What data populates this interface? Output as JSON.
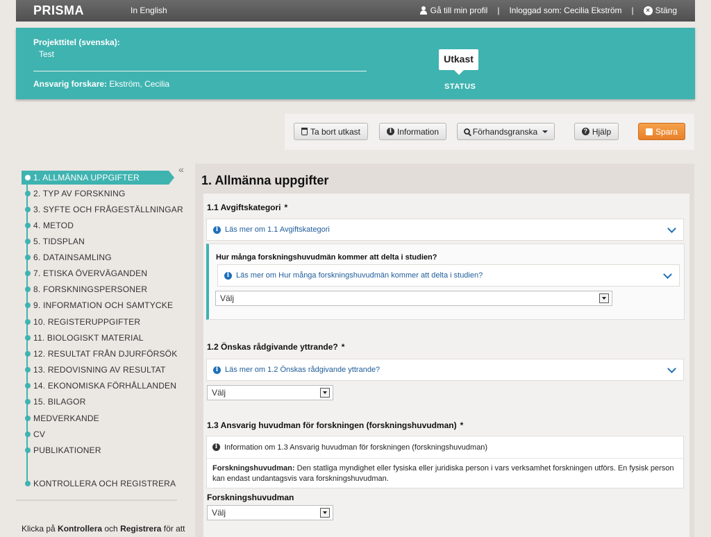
{
  "topbar": {
    "brand": "PRISMA",
    "language_link": "In English",
    "profile_link": "Gå till min profil",
    "separator": "|",
    "logged_in": "Inloggad som: Cecilia Ekström",
    "close_link": "Stäng"
  },
  "project": {
    "title_label": "Projekttitel (svenska):",
    "title_value": "Test",
    "responsible_label": "Ansvarig forskare:",
    "responsible_value": "Ekström, Cecilia",
    "status_value": "Utkast",
    "status_label": "STATUS"
  },
  "toolbar": {
    "delete_label": "Ta bort utkast",
    "info_label": "Information",
    "preview_label": "Förhandsgranska",
    "help_label": "Hjälp",
    "save_label": "Spara"
  },
  "sidebar": {
    "collapse_glyph": "«",
    "items": [
      {
        "label": "1. ALLMÄNNA UPPGIFTER"
      },
      {
        "label": "2. TYP AV FORSKNING"
      },
      {
        "label": "3. SYFTE OCH FRÅGESTÄLLNINGAR"
      },
      {
        "label": "4. METOD"
      },
      {
        "label": "5. TIDSPLAN"
      },
      {
        "label": "6. DATAINSAMLING"
      },
      {
        "label": "7. ETISKA ÖVERVÄGANDEN"
      },
      {
        "label": "8. FORSKNINGSPERSONER"
      },
      {
        "label": "9. INFORMATION OCH SAMTYCKE"
      },
      {
        "label": "10. REGISTERUPPGIFTER"
      },
      {
        "label": "11. BIOLOGISKT MATERIAL"
      },
      {
        "label": "12. RESULTAT FRÅN DJURFÖRSÖK"
      },
      {
        "label": "13. REDOVISNING AV RESULTAT"
      },
      {
        "label": "14. EKONOMISKA FÖRHÅLLANDEN"
      },
      {
        "label": "15. BILAGOR"
      },
      {
        "label": "MEDVERKANDE"
      },
      {
        "label": "CV"
      },
      {
        "label": "PUBLIKATIONER"
      },
      {
        "label": "KONTROLLERA OCH REGISTRERA"
      }
    ],
    "hint_prefix": "Klicka på ",
    "hint_bold1": "Kontrollera",
    "hint_mid": " och ",
    "hint_bold2": "Registrera",
    "hint_suffix": " för att"
  },
  "main": {
    "heading": "1. Allmänna uppgifter",
    "q1": {
      "title": "1.1 Avgiftskategori",
      "required": "*",
      "info": "Läs mer om 1.1 Avgiftskategori",
      "sub_question": "Hur många forskningshuvudmän kommer att delta i studien?",
      "sub_info": "Läs mer om Hur många forskningshuvudmän kommer att delta i studien?",
      "select_value": "Välj"
    },
    "q2": {
      "title": "1.2 Önskas rådgivande yttrande?",
      "required": "*",
      "info": "Läs mer om 1.2 Önskas rådgivande yttrande?",
      "select_value": "Välj"
    },
    "q3": {
      "title": "1.3 Ansvarig huvudman för forskningen (forskningshuvudman)",
      "required": "*",
      "info_head": "Information om 1.3 Ansvarig huvudman för forskningen (forskningshuvudman)",
      "info_term": "Forskningshuvudman:",
      "info_text": " Den statliga myndighet eller fysiska eller juridiska person i vars verksamhet forskningen utförs. En fysisk person kan endast undantagsvis vara forskningshuvudman.",
      "field_label": "Forskningshuvudman",
      "select_value": "Välj"
    }
  }
}
